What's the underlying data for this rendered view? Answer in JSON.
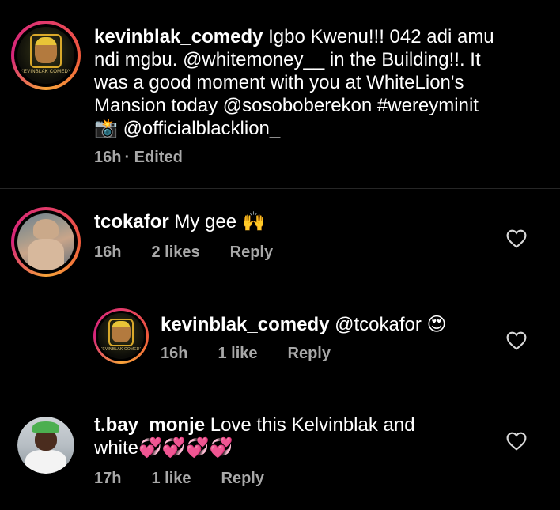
{
  "caption": {
    "username": "kevinblak_comedy",
    "text_parts": [
      "Igbo Kwenu!!! 042 adi amu",
      "ndi mgbu.  @whitemoney__ in the Building!!. It",
      "was a good moment with you at WhiteLion's",
      "Mansion today @sosoboberekon #wereyminit",
      "@officialblacklion_"
    ],
    "avatar_label": "KEVINBLAK COMEDY",
    "time": "16h",
    "edited": "· Edited"
  },
  "comments": [
    {
      "username": "tcokafor",
      "text": "My gee",
      "emoji": "🙌",
      "time": "16h",
      "likes": "2 likes",
      "reply": "Reply"
    },
    {
      "username": "kevinblak_comedy",
      "mention": "@tcokafor",
      "emoji": "😍",
      "avatar_label": "KEVINBLAK COMEDY",
      "time": "16h",
      "likes": "1 like",
      "reply": "Reply"
    },
    {
      "username": "t.bay_monje",
      "text_line1": "Love this Kelvinblak and",
      "text_line2": "white",
      "emoji": "💞💞💞💞",
      "time": "17h",
      "likes": "1 like",
      "reply": "Reply"
    }
  ],
  "colors": {
    "background": "#000000",
    "text": "#ffffff",
    "meta": "#a8a8a8",
    "divider": "#262626",
    "ring_gradient": [
      "#e23a6b",
      "#f7a33a",
      "#d6247a"
    ]
  },
  "icons": {
    "like": "heart-outline-icon",
    "camera": "camera-emoji"
  }
}
